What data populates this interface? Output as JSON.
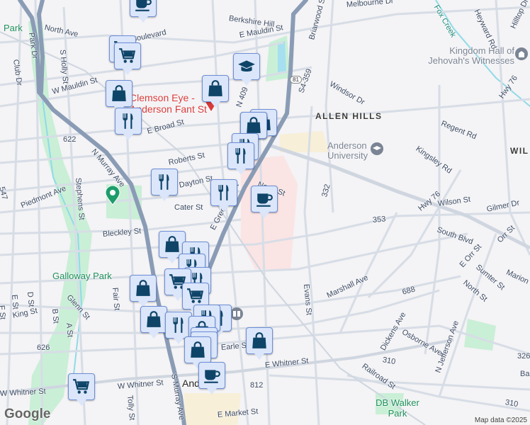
{
  "map": {
    "streets": [
      "North Ave",
      "Park Dr",
      "Club Dr",
      "S Holly St",
      "Boulevard",
      "E Mauldin St",
      "Berkshire Hill",
      "W Mauldin St",
      "N 409",
      "E Broad St",
      "622",
      "N Murray Ave",
      "Stephens St",
      "547",
      "Piedmont Ave",
      "Roberts St",
      "Dayton St",
      "Cater St",
      "E Greenville St",
      "North St",
      "Bleckley St",
      "Fair St",
      "Glenn St",
      "E St",
      "D St",
      "B St",
      "A St",
      "F St",
      "King St",
      "626",
      "W Whitner St",
      "Tolly St",
      "S Murray Ave",
      "812",
      "E Market St",
      "Earle St",
      "Melbourne Dr",
      "Briarwood St",
      "S4-359",
      "Windsor Dr",
      "Regent Rd",
      "Kingsley Rd",
      "Hwy 76",
      "Hwy 76",
      "Wilson St",
      "Gilmer Dr",
      "332",
      "353",
      "South Blvd",
      "Orr St",
      "E Orr St",
      "Sumter St",
      "Marion",
      "North St",
      "Marshall Ave",
      "Evans St",
      "688",
      "Dickens Ave",
      "Osborne Ave",
      "N Jefferson Ave",
      "310",
      "310",
      "E Whitner St",
      "Railroad St",
      "326",
      "Heyward Rd",
      "Hilltop Dr",
      "Fox Creek",
      "Ba"
    ],
    "places": {
      "park_nw": "Park",
      "galloway": "Galloway Park",
      "db_walker": "DB Walker Park",
      "allen_hills": "ALLEN HILLS",
      "anderson_univ": "Anderson University",
      "kingdom_hall": "Kingdom Hall of Jehovah's Witnesses",
      "clemson_eye": "Clemson Eye - Anderson Fant St",
      "town": "Anderson",
      "wil": "WIL"
    },
    "route_shield": "81",
    "attribution": "Map data ©2025",
    "logo": "Google",
    "marker_types": [
      "shopping-bag",
      "shopping-cart",
      "restaurant",
      "cafe",
      "school"
    ]
  }
}
